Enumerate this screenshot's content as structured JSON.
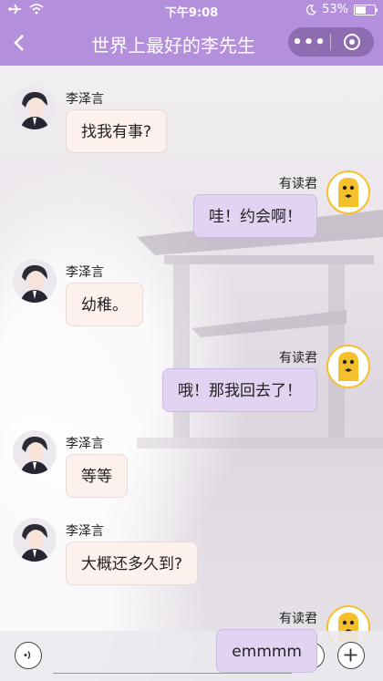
{
  "status_bar": {
    "airplane_icon": "airplane-icon",
    "wifi_icon": "wifi-icon",
    "time": "下午9:08",
    "moon_icon": "moon-icon",
    "battery_percent": "53%",
    "battery_level": 0.53
  },
  "nav": {
    "back_label": "<",
    "title": "世界上最好的李先生",
    "more_label": "•••",
    "close_icon": "target-icon"
  },
  "messages": [
    {
      "sender": "李泽言",
      "side": "left",
      "text": "找我有事?"
    },
    {
      "sender": "有读君",
      "side": "right",
      "text": "哇！约会啊！"
    },
    {
      "sender": "李泽言",
      "side": "left",
      "text": "幼稚。"
    },
    {
      "sender": "有读君",
      "side": "right",
      "text": "哦！那我回去了！"
    },
    {
      "sender": "李泽言",
      "side": "left",
      "text": "等等"
    },
    {
      "sender": "李泽言",
      "side": "left",
      "text": "大概还多久到?"
    },
    {
      "sender": "有读君",
      "side": "right",
      "text": "emmmm"
    }
  ],
  "input_bar": {
    "value": "",
    "placeholder": "",
    "voice_icon": "voice-icon",
    "emoji_icon": "emoji-icon",
    "plus_icon": "plus-icon"
  },
  "colors": {
    "header": "#b48fdc",
    "left_bubble": "#fdf1ee",
    "right_bubble": "#e3d3f2",
    "avatar_yellow": "#f5c02a"
  }
}
